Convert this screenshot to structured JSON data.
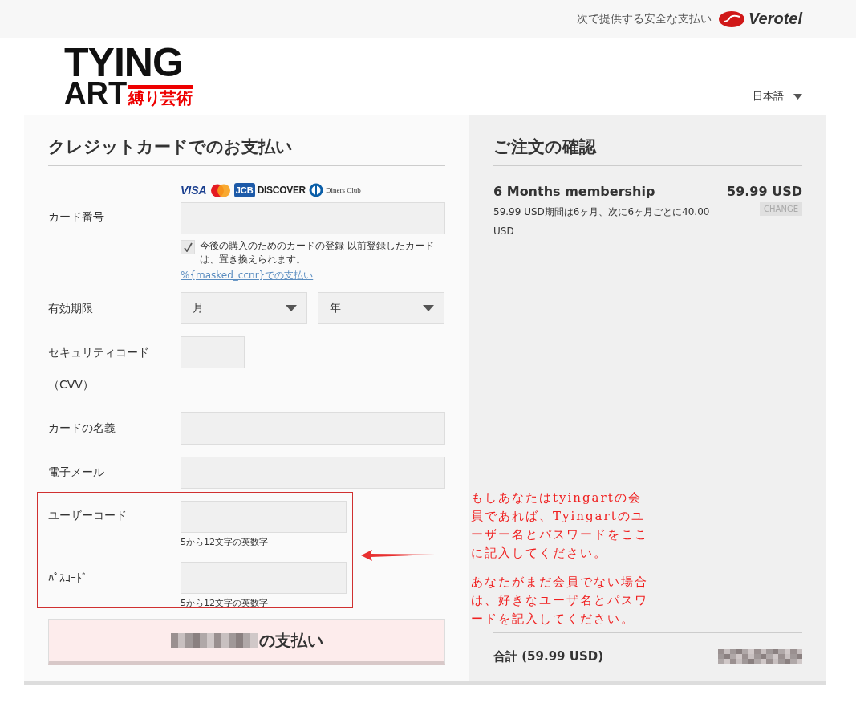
{
  "top_bar": {
    "secure_text": "次で提供する安全な支払い",
    "brand": "Verotel"
  },
  "logo": {
    "line_1": "TYING",
    "line_2": "ART",
    "subtitle": "縛り芸術"
  },
  "language": {
    "value": "日本語"
  },
  "payment": {
    "title": "クレジットカードでのお支払い",
    "card_logos": [
      {
        "kind": "visa",
        "text": "VISA"
      },
      {
        "kind": "mastercard"
      },
      {
        "kind": "jcb",
        "text": "JCB"
      },
      {
        "kind": "discover",
        "text": "DISCOVER"
      },
      {
        "kind": "diners",
        "text": "Diners Club"
      }
    ],
    "card_number": {
      "label": "カード番号",
      "save_card": {
        "checked": true,
        "text": "今後の購入のためのカードの登録 以前登録したカードは、置き換えられます。"
      },
      "saved_card_link": "%{masked_ccnr}での支払い"
    },
    "expiry": {
      "label": "有効期限",
      "month": "月",
      "year": "年"
    },
    "security_code": {
      "label": "セキュリティコード",
      "label_note": "（CVV）"
    },
    "card_holder": {
      "label": "カードの名義"
    },
    "email": {
      "label": "電子メール"
    },
    "username": {
      "label": "ユーザーコード",
      "hint": "5から12文字の英数字"
    },
    "password": {
      "label": "ﾊﾟｽｺｰﾄﾞ",
      "hint": "5から12文字の英数字"
    },
    "pay_button": {
      "text": "の支払い"
    }
  },
  "annotation": {
    "paragraphs": [
      "もしあなたはtyingartの会員であれば、Tyingartのユーザー名とパスワードをここに記入してください。",
      "あなたがまだ会員でない場合は、好きなユーザ名とパスワードを記入してください。"
    ]
  },
  "order": {
    "title": "ご注文の確認",
    "item": {
      "name": "6 Months membership",
      "price": "59.99 USD",
      "description": "59.99 USD期間は6ヶ月、次に6ヶ月ごとに40.00 USD",
      "change": "CHANGE"
    },
    "total": {
      "label": "合計 (59.99 USD)"
    }
  }
}
